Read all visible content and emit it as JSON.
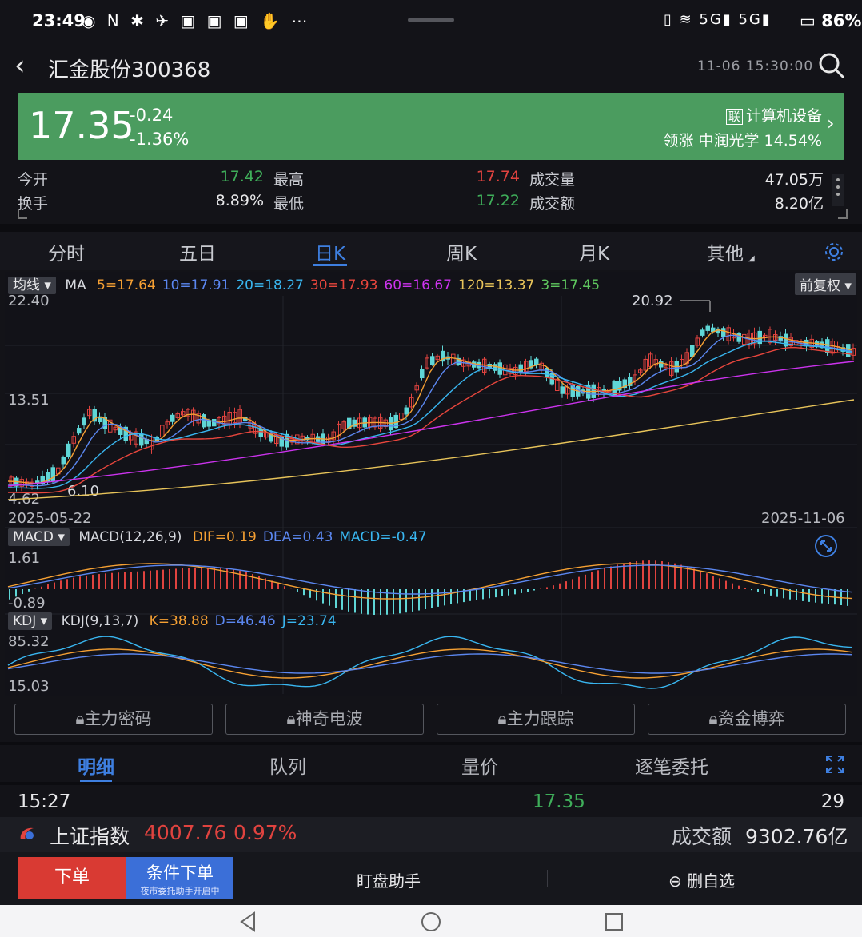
{
  "status_bar": {
    "time": "23:49",
    "battery": "86%",
    "signal": "5G 5G"
  },
  "header": {
    "stock_title": "汇金股份300368",
    "datetime": "11-06 15:30:00"
  },
  "banner": {
    "price": "17.35",
    "change": "-0.24",
    "change_pct": "-1.36%",
    "industry_tag": "联",
    "industry": "计算机设备",
    "leader_label": "领涨 中润光学 14.54%"
  },
  "quote": {
    "open_label": "今开",
    "open_value": "17.42",
    "high_label": "最高",
    "high_value": "17.74",
    "volume_label": "成交量",
    "volume_value": "47.05万",
    "turnover_label": "换手",
    "turnover_value": "8.89%",
    "low_label": "最低",
    "low_value": "17.22",
    "amount_label": "成交额",
    "amount_value": "8.20亿"
  },
  "period_tabs": [
    "分时",
    "五日",
    "日K",
    "周K",
    "月K",
    "其他"
  ],
  "period_active": 2,
  "ma_legend": {
    "dropdown": "均线",
    "prefix": "MA",
    "items": [
      {
        "text": "5=17.64",
        "color": "#f5a033"
      },
      {
        "text": "10=17.91",
        "color": "#5b87f0"
      },
      {
        "text": "20=18.27",
        "color": "#39b6f0"
      },
      {
        "text": "30=17.93",
        "color": "#e8463d"
      },
      {
        "text": "60=16.67",
        "color": "#cc33ee"
      },
      {
        "text": "120=13.37",
        "color": "#e8c45a"
      },
      {
        "text": "3=17.45",
        "color": "#5fc85f"
      }
    ],
    "adjust": "前复权"
  },
  "price_axis": {
    "top": "22.40",
    "mid": "13.51",
    "bottom": "4.62"
  },
  "price_annotations": {
    "high": "20.92",
    "low": "6.10"
  },
  "date_axis": {
    "start": "2025-05-22",
    "end": "2025-11-06"
  },
  "macd_legend": {
    "dropdown": "MACD",
    "name": "MACD(12,26,9)",
    "items": [
      {
        "text": "DIF=0.19",
        "color": "#f5a033"
      },
      {
        "text": "DEA=0.43",
        "color": "#5b87f0"
      },
      {
        "text": "MACD=-0.47",
        "color": "#39b6f0"
      }
    ],
    "top": "1.61",
    "bottom": "-0.89"
  },
  "kdj_legend": {
    "dropdown": "KDJ",
    "name": "KDJ(9,13,7)",
    "items": [
      {
        "text": "K=38.88",
        "color": "#f5a033"
      },
      {
        "text": "D=46.46",
        "color": "#5b87f0"
      },
      {
        "text": "J=23.74",
        "color": "#39b6f0"
      }
    ],
    "top": "85.32",
    "bottom": "15.03"
  },
  "lock_buttons": [
    "主力密码",
    "神奇电波",
    "主力跟踪",
    "资金博弈"
  ],
  "detail_tabs": [
    "明细",
    "队列",
    "量价",
    "逐笔委托"
  ],
  "detail_row": {
    "time": "15:27",
    "price": "17.35",
    "volume": "29"
  },
  "index_bar": {
    "name": "上证指数",
    "value": "4007.76",
    "pct": "0.97%",
    "amount_label": "成交额",
    "amount": "9302.76亿"
  },
  "actions": {
    "order": "下单",
    "cond_order": "条件下单",
    "cond_sub": "夜市委托助手开启中",
    "watch": "盯盘助手",
    "remove": "删自选"
  }
}
